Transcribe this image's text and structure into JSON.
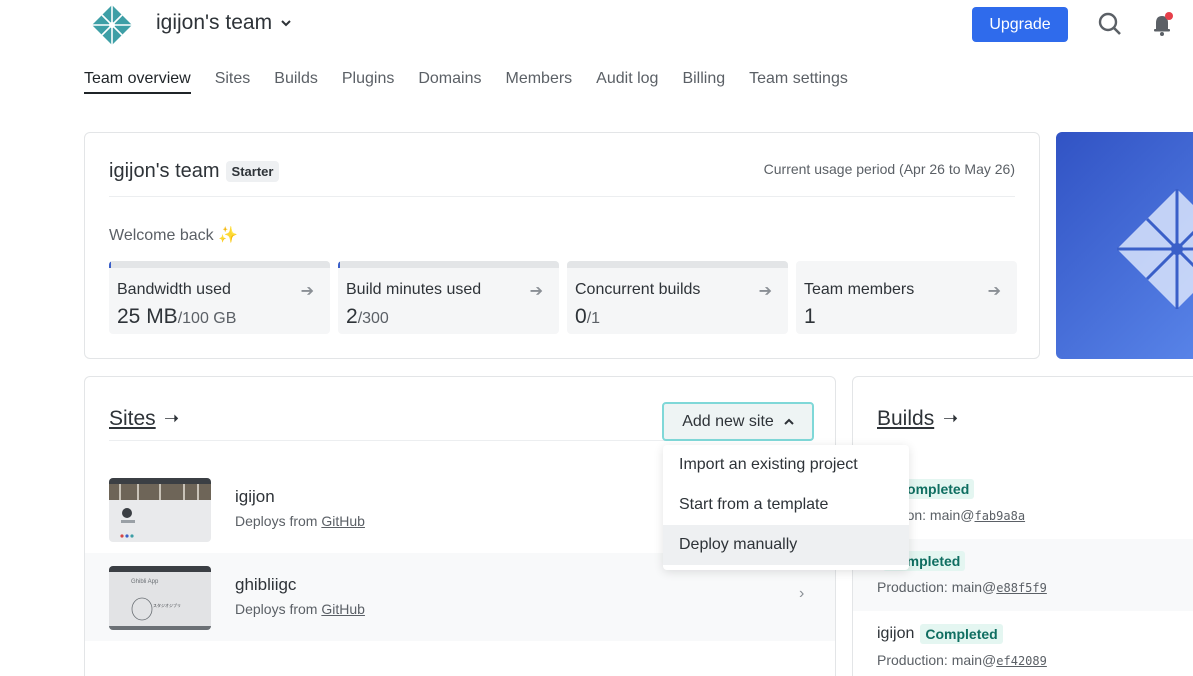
{
  "header": {
    "team_name": "igijon's team",
    "upgrade_label": "Upgrade"
  },
  "nav": {
    "tabs": [
      {
        "label": "Team overview",
        "active": true
      },
      {
        "label": "Sites"
      },
      {
        "label": "Builds"
      },
      {
        "label": "Plugins"
      },
      {
        "label": "Domains"
      },
      {
        "label": "Members"
      },
      {
        "label": "Audit log"
      },
      {
        "label": "Billing"
      },
      {
        "label": "Team settings"
      }
    ]
  },
  "overview": {
    "team_name": "igijon's team",
    "plan_badge": "Starter",
    "usage_period": "Current usage period (Apr 26 to May 26)",
    "welcome": "Welcome back ✨",
    "stats": [
      {
        "label": "Bandwidth used",
        "value": "25 MB",
        "limit": "/100 GB",
        "fraction": 0.00025
      },
      {
        "label": "Build minutes used",
        "value": "2",
        "limit": "/300",
        "fraction": 0.0067
      },
      {
        "label": "Concurrent builds",
        "value": "0",
        "limit": "/1",
        "fraction": 0
      },
      {
        "label": "Team members",
        "value": "1",
        "limit": ""
      }
    ]
  },
  "sites": {
    "title": "Sites",
    "add_button": "Add new site",
    "dropdown": [
      "Import an existing project",
      "Start from a template",
      "Deploy manually"
    ],
    "items": [
      {
        "name": "igijon",
        "deploy_prefix": "Deploys from",
        "source": "GitHub"
      },
      {
        "name": "ghibliigc",
        "deploy_prefix": "Deploys from",
        "source": "GitHub",
        "thumb_title": "Ghibli App",
        "thumb_text": "スタジオジブリ"
      }
    ]
  },
  "builds": {
    "title": "Builds",
    "items": [
      {
        "site": "n",
        "status": "Completed",
        "context": "duction: main@",
        "sha": "fab9a8a"
      },
      {
        "site": "",
        "status": "Completed",
        "context": "Production: main@",
        "sha": "e88f5f9"
      },
      {
        "site": "igijon",
        "status": "Completed",
        "context": "Production: main@",
        "sha": "ef42089"
      }
    ]
  },
  "colors": {
    "accent": "#2f6bec",
    "status_completed": "#0f6e61",
    "status_completed_bg": "#e4f6f1",
    "notification_dot": "#e63f4a"
  }
}
